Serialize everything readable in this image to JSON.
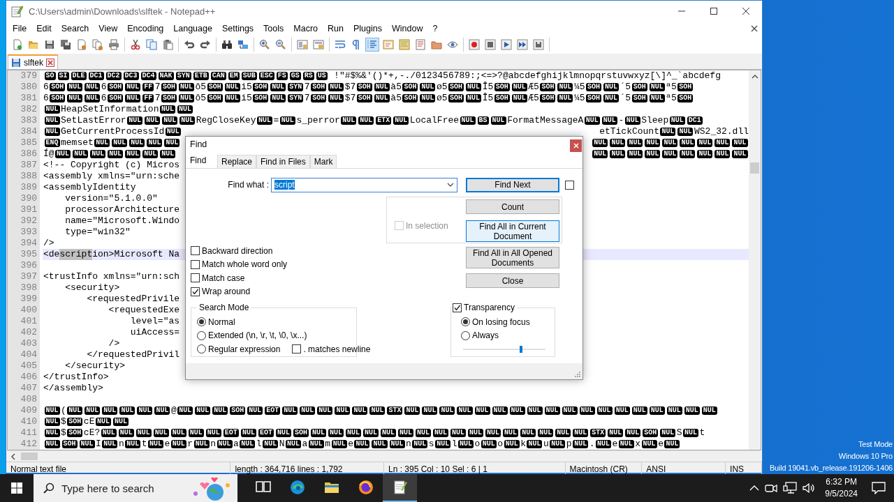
{
  "window": {
    "title": "C:\\Users\\admin\\Downloads\\slftek - Notepad++"
  },
  "menu": [
    "File",
    "Edit",
    "Search",
    "View",
    "Encoding",
    "Language",
    "Settings",
    "Tools",
    "Macro",
    "Run",
    "Plugins",
    "Window",
    "?"
  ],
  "toolbar": [
    [
      {
        "kind": "new",
        "pressed": false
      },
      {
        "kind": "open",
        "pressed": false
      },
      {
        "kind": "save",
        "pressed": false
      },
      {
        "kind": "save-all",
        "pressed": false
      },
      {
        "kind": "close",
        "pressed": false
      },
      {
        "kind": "close-all",
        "pressed": false
      },
      {
        "kind": "print",
        "pressed": false
      }
    ],
    [
      {
        "kind": "cut",
        "pressed": false
      },
      {
        "kind": "copy",
        "pressed": false
      },
      {
        "kind": "paste",
        "pressed": false
      }
    ],
    [
      {
        "kind": "undo",
        "pressed": false
      },
      {
        "kind": "redo",
        "pressed": false
      }
    ],
    [
      {
        "kind": "find",
        "pressed": false
      },
      {
        "kind": "replace",
        "pressed": false
      }
    ],
    [
      {
        "kind": "zoom-in",
        "pressed": false
      },
      {
        "kind": "zoom-out",
        "pressed": false
      }
    ],
    [
      {
        "kind": "sync-v",
        "pressed": false
      },
      {
        "kind": "sync-h",
        "pressed": false
      }
    ],
    [
      {
        "kind": "wrap",
        "pressed": false
      },
      {
        "kind": "all-chars",
        "pressed": false
      },
      {
        "kind": "indent",
        "pressed": true
      },
      {
        "kind": "udl",
        "pressed": false
      },
      {
        "kind": "map",
        "pressed": false
      },
      {
        "kind": "func",
        "pressed": false
      },
      {
        "kind": "folder",
        "pressed": false
      },
      {
        "kind": "monitor",
        "pressed": false
      }
    ],
    [
      {
        "kind": "record",
        "pressed": false
      },
      {
        "kind": "stop",
        "pressed": false
      },
      {
        "kind": "play",
        "pressed": false
      },
      {
        "kind": "play-multi",
        "pressed": false
      },
      {
        "kind": "save-macro",
        "pressed": false
      }
    ]
  ],
  "tabs": [
    {
      "label": "slftek",
      "selected": true
    }
  ],
  "editor": {
    "lines": [
      {
        "number": "379",
        "current": false,
        "segments": [
          {
            "ctrl": "SO"
          },
          {
            "ctrl": "SI"
          },
          {
            "ctrl": "DLE"
          },
          {
            "ctrl": "DC1"
          },
          {
            "ctrl": "DC2"
          },
          {
            "ctrl": "DC3"
          },
          {
            "ctrl": "DC4"
          },
          {
            "ctrl": "NAK"
          },
          {
            "ctrl": "SYN"
          },
          {
            "ctrl": "ETB"
          },
          {
            "ctrl": "CAN"
          },
          {
            "ctrl": "EM"
          },
          {
            "ctrl": "SUB"
          },
          {
            "ctrl": "ESC"
          },
          {
            "ctrl": "FS"
          },
          {
            "ctrl": "GS"
          },
          {
            "ctrl": "RS"
          },
          {
            "ctrl": "US"
          },
          {
            "text": " !\"#$%&'()*+,-./0123456789:;<=>?@abcdefghijklmnopqrstuvwxyz[\\]^_`abcdefg"
          }
        ]
      },
      {
        "number": "380",
        "current": false,
        "segments": [
          {
            "text": "6"
          },
          {
            "ctrl": "SOH"
          },
          {
            "ctrl": "NUL"
          },
          {
            "ctrl": "NUL"
          },
          {
            "text": "6"
          },
          {
            "ctrl": "SOH"
          },
          {
            "ctrl": "NUL"
          },
          {
            "ctrl": "FF"
          },
          {
            "text": "7"
          },
          {
            "ctrl": "SOH"
          },
          {
            "ctrl": "NUL"
          },
          {
            "text": "ô5"
          },
          {
            "ctrl": "SOH"
          },
          {
            "ctrl": "NUL"
          },
          {
            "text": "i5"
          },
          {
            "ctrl": "SOH"
          },
          {
            "ctrl": "NUL"
          },
          {
            "ctrl": "SYN"
          },
          {
            "text": "7"
          },
          {
            "ctrl": "SOH"
          },
          {
            "ctrl": "NUL"
          },
          {
            "text": "$7"
          },
          {
            "ctrl": "SOH"
          },
          {
            "ctrl": "NUL"
          },
          {
            "text": "à5"
          },
          {
            "ctrl": "SOH"
          },
          {
            "ctrl": "NUL"
          },
          {
            "text": "ø5"
          },
          {
            "ctrl": "SOH"
          },
          {
            "ctrl": "NUL"
          },
          {
            "text": "Î5"
          },
          {
            "ctrl": "SOH"
          },
          {
            "ctrl": "NUL"
          },
          {
            "text": "Æ5"
          },
          {
            "ctrl": "SOH"
          },
          {
            "ctrl": "NUL"
          },
          {
            "text": "¼5"
          },
          {
            "ctrl": "SOH"
          },
          {
            "ctrl": "NUL"
          },
          {
            "text": "´5"
          },
          {
            "ctrl": "SOH"
          },
          {
            "ctrl": "NUL"
          },
          {
            "text": "ª5"
          },
          {
            "ctrl": "SOH"
          }
        ]
      },
      {
        "number": "381",
        "current": false,
        "segments": [
          {
            "text": "6"
          },
          {
            "ctrl": "SOH"
          },
          {
            "ctrl": "NUL"
          },
          {
            "ctrl": "NUL"
          },
          {
            "text": "6"
          },
          {
            "ctrl": "SOH"
          },
          {
            "ctrl": "NUL"
          },
          {
            "ctrl": "FF"
          },
          {
            "text": "7"
          },
          {
            "ctrl": "SOH"
          },
          {
            "ctrl": "NUL"
          },
          {
            "text": "ô5"
          },
          {
            "ctrl": "SOH"
          },
          {
            "ctrl": "NUL"
          },
          {
            "text": "i5"
          },
          {
            "ctrl": "SOH"
          },
          {
            "ctrl": "NUL"
          },
          {
            "ctrl": "SYN"
          },
          {
            "text": "7"
          },
          {
            "ctrl": "SOH"
          },
          {
            "ctrl": "NUL"
          },
          {
            "text": "$7"
          },
          {
            "ctrl": "SOH"
          },
          {
            "ctrl": "NUL"
          },
          {
            "text": "à5"
          },
          {
            "ctrl": "SOH"
          },
          {
            "ctrl": "NUL"
          },
          {
            "text": "ø5"
          },
          {
            "ctrl": "SOH"
          },
          {
            "ctrl": "NUL"
          },
          {
            "text": "Î5"
          },
          {
            "ctrl": "SOH"
          },
          {
            "ctrl": "NUL"
          },
          {
            "text": "Æ5"
          },
          {
            "ctrl": "SOH"
          },
          {
            "ctrl": "NUL"
          },
          {
            "text": "¼5"
          },
          {
            "ctrl": "SOH"
          },
          {
            "ctrl": "NUL"
          },
          {
            "text": "´5"
          },
          {
            "ctrl": "SOH"
          },
          {
            "ctrl": "NUL"
          },
          {
            "text": "ª5"
          },
          {
            "ctrl": "SOH"
          }
        ]
      },
      {
        "number": "382",
        "current": false,
        "segments": [
          {
            "ctrl": "NUL"
          },
          {
            "text": "HeapSetInformation"
          },
          {
            "ctrl": "NUL"
          },
          {
            "ctrl": "NUL"
          }
        ]
      },
      {
        "number": "383",
        "current": false,
        "segments": [
          {
            "ctrl": "NUL"
          },
          {
            "text": "SetLastError"
          },
          {
            "ctrl": "NUL"
          },
          {
            "ctrl": "NUL"
          },
          {
            "ctrl": "NUL"
          },
          {
            "ctrl": "NUL"
          },
          {
            "text": "RegCloseKey"
          },
          {
            "ctrl": "NUL"
          },
          {
            "text": "="
          },
          {
            "ctrl": "NUL"
          },
          {
            "text": "s_perror"
          },
          {
            "ctrl": "NUL"
          },
          {
            "ctrl": "NUL"
          },
          {
            "ctrl": "ETX"
          },
          {
            "ctrl": "NUL"
          },
          {
            "text": "LocalFree"
          },
          {
            "ctrl": "NUL"
          },
          {
            "ctrl": "BS"
          },
          {
            "ctrl": "NUL"
          },
          {
            "text": "FormatMessageA"
          },
          {
            "ctrl": "NUL"
          },
          {
            "ctrl": "NUL"
          },
          {
            "text": "-"
          },
          {
            "ctrl": "NUL"
          },
          {
            "text": "Sleep"
          },
          {
            "ctrl": "NUL"
          },
          {
            "ctrl": "DC1"
          }
        ]
      },
      {
        "number": "384",
        "current": false,
        "segments": [
          {
            "ctrl": "NUL"
          },
          {
            "text": "GetCurrentProcessId"
          },
          {
            "ctrl": "NUL"
          }
        ],
        "tail": [
          {
            "text": "etTickCount"
          },
          {
            "ctrl": "NUL"
          },
          {
            "ctrl": "NUL"
          },
          {
            "text": "WS2_32.dll"
          }
        ]
      },
      {
        "number": "385",
        "current": false,
        "segments": [
          {
            "ctrl": "ENQ"
          },
          {
            "text": "memset"
          },
          {
            "ctrl": "NUL"
          },
          {
            "ctrl": "NUL"
          },
          {
            "ctrl": "NUL"
          },
          {
            "ctrl": "NUL"
          },
          {
            "ctrl": "NUL"
          }
        ],
        "tail": [
          {
            "ctrl": "NUL"
          },
          {
            "ctrl": "NUL"
          },
          {
            "ctrl": "NUL"
          },
          {
            "ctrl": "NUL"
          },
          {
            "ctrl": "NUL"
          },
          {
            "ctrl": "NUL"
          },
          {
            "ctrl": "NUL"
          },
          {
            "ctrl": "NUL"
          },
          {
            "ctrl": "NUL"
          }
        ]
      },
      {
        "number": "386",
        "current": false,
        "segments": [
          {
            "text": "Í@"
          },
          {
            "ctrl": "NUL"
          },
          {
            "ctrl": "NUL"
          },
          {
            "ctrl": "NUL"
          },
          {
            "ctrl": "NUL"
          },
          {
            "ctrl": "NUL"
          },
          {
            "ctrl": "NUL"
          },
          {
            "ctrl": "NUL"
          }
        ],
        "tail": [
          {
            "ctrl": "NUL"
          },
          {
            "ctrl": "NUL"
          },
          {
            "ctrl": "NUL"
          },
          {
            "ctrl": "NUL"
          },
          {
            "ctrl": "NUL"
          },
          {
            "ctrl": "NUL"
          },
          {
            "ctrl": "NUL"
          },
          {
            "ctrl": "NUL"
          },
          {
            "ctrl": "NUL"
          }
        ]
      },
      {
        "number": "387",
        "current": false,
        "segments": [
          {
            "text": "<!-- Copyright (c) Micros"
          }
        ]
      },
      {
        "number": "388",
        "current": false,
        "segments": [
          {
            "text": "<assembly xmlns=\"urn:sche"
          }
        ]
      },
      {
        "number": "389",
        "current": false,
        "segments": [
          {
            "text": "<assemblyIdentity"
          }
        ]
      },
      {
        "number": "390",
        "current": false,
        "segments": [
          {
            "text": "    version=\"5.1.0.0\""
          }
        ]
      },
      {
        "number": "391",
        "current": false,
        "segments": [
          {
            "text": "    processorArchitecture"
          }
        ]
      },
      {
        "number": "392",
        "current": false,
        "segments": [
          {
            "text": "    name=\"Microsoft.Windo"
          }
        ]
      },
      {
        "number": "393",
        "current": false,
        "segments": [
          {
            "text": "    type=\"win32\""
          }
        ]
      },
      {
        "number": "394",
        "current": false,
        "segments": [
          {
            "text": "/>"
          }
        ]
      },
      {
        "number": "395",
        "current": true,
        "segments": [
          {
            "text": "<de"
          },
          {
            "match": "script"
          },
          {
            "text": "ion>Microsoft Na"
          }
        ]
      },
      {
        "number": "396",
        "current": false
      },
      {
        "number": "397",
        "current": false,
        "segments": [
          {
            "text": "<trustInfo xmlns=\"urn:sch"
          }
        ]
      },
      {
        "number": "398",
        "current": false,
        "segments": [
          {
            "text": "    <security>"
          }
        ]
      },
      {
        "number": "399",
        "current": false,
        "segments": [
          {
            "text": "        <requestedPrivile"
          }
        ]
      },
      {
        "number": "400",
        "current": false,
        "segments": [
          {
            "text": "            <requestedExe"
          }
        ]
      },
      {
        "number": "401",
        "current": false,
        "segments": [
          {
            "text": "                level=\"as"
          }
        ]
      },
      {
        "number": "402",
        "current": false,
        "segments": [
          {
            "text": "                uiAccess="
          }
        ]
      },
      {
        "number": "403",
        "current": false,
        "segments": [
          {
            "text": "            />"
          }
        ]
      },
      {
        "number": "404",
        "current": false,
        "segments": [
          {
            "text": "        </requestedPrivil"
          }
        ]
      },
      {
        "number": "405",
        "current": false,
        "segments": [
          {
            "text": "    </security>"
          }
        ]
      },
      {
        "number": "406",
        "current": false,
        "segments": [
          {
            "text": "</trustInfo>"
          }
        ]
      },
      {
        "number": "407",
        "current": false,
        "segments": [
          {
            "text": "</assembly>"
          }
        ]
      },
      {
        "number": "408",
        "current": false
      },
      {
        "number": "409",
        "current": false,
        "segments": [
          {
            "ctrl": "NUL"
          },
          {
            "text": "("
          },
          {
            "ctrl": "NUL"
          },
          {
            "ctrl": "NUL"
          },
          {
            "ctrl": "NUL"
          },
          {
            "ctrl": "NUL"
          },
          {
            "ctrl": "NUL"
          },
          {
            "ctrl": "NUL"
          },
          {
            "text": "@"
          },
          {
            "ctrl": "NUL"
          },
          {
            "ctrl": "NUL"
          },
          {
            "ctrl": "NUL"
          },
          {
            "ctrl": "SOH"
          },
          {
            "ctrl": "NUL"
          },
          {
            "ctrl": "EOT"
          },
          {
            "ctrl": "NUL"
          },
          {
            "ctrl": "NUL"
          },
          {
            "ctrl": "NUL"
          },
          {
            "ctrl": "NUL"
          },
          {
            "ctrl": "NUL"
          },
          {
            "ctrl": "NUL"
          },
          {
            "ctrl": "STX"
          },
          {
            "ctrl": "NUL"
          },
          {
            "ctrl": "NUL"
          },
          {
            "ctrl": "NUL"
          },
          {
            "ctrl": "NUL"
          },
          {
            "ctrl": "NUL"
          },
          {
            "ctrl": "NUL"
          },
          {
            "ctrl": "NUL"
          },
          {
            "ctrl": "NUL"
          },
          {
            "ctrl": "NUL"
          },
          {
            "ctrl": "NUL"
          },
          {
            "ctrl": "NUL"
          },
          {
            "ctrl": "NUL"
          },
          {
            "ctrl": "NUL"
          },
          {
            "ctrl": "NUL"
          },
          {
            "ctrl": "NUL"
          },
          {
            "ctrl": "NUL"
          },
          {
            "ctrl": "NUL"
          },
          {
            "ctrl": "NUL"
          }
        ]
      },
      {
        "number": "410",
        "current": false,
        "segments": [
          {
            "ctrl": "NUL"
          },
          {
            "text": "$"
          },
          {
            "ctrl": "SOH"
          },
          {
            "text": "cE"
          },
          {
            "ctrl": "NUL"
          },
          {
            "ctrl": "NUL"
          }
        ]
      },
      {
        "number": "411",
        "current": false,
        "segments": [
          {
            "ctrl": "NUL"
          },
          {
            "text": "$"
          },
          {
            "ctrl": "SOH"
          },
          {
            "text": "cE?"
          },
          {
            "ctrl": "NUL"
          },
          {
            "ctrl": "NUL"
          },
          {
            "ctrl": "NUL"
          },
          {
            "ctrl": "NUL"
          },
          {
            "ctrl": "NUL"
          },
          {
            "ctrl": "NUL"
          },
          {
            "ctrl": "NUL"
          },
          {
            "ctrl": "EOT"
          },
          {
            "ctrl": "NUL"
          },
          {
            "ctrl": "EOT"
          },
          {
            "ctrl": "NUL"
          },
          {
            "ctrl": "SOH"
          },
          {
            "ctrl": "NUL"
          },
          {
            "ctrl": "NUL"
          },
          {
            "ctrl": "NUL"
          },
          {
            "ctrl": "NUL"
          },
          {
            "ctrl": "NUL"
          },
          {
            "ctrl": "NUL"
          },
          {
            "ctrl": "NUL"
          },
          {
            "ctrl": "NUL"
          },
          {
            "ctrl": "NUL"
          },
          {
            "ctrl": "NUL"
          },
          {
            "ctrl": "NUL"
          },
          {
            "ctrl": "NUL"
          },
          {
            "ctrl": "NUL"
          },
          {
            "ctrl": "NUL"
          },
          {
            "ctrl": "NUL"
          },
          {
            "ctrl": "NUL"
          },
          {
            "ctrl": "STX"
          },
          {
            "ctrl": "NUL"
          },
          {
            "ctrl": "NUL"
          },
          {
            "ctrl": "SOH"
          },
          {
            "ctrl": "NUL"
          },
          {
            "text": "S"
          },
          {
            "ctrl": "NUL"
          },
          {
            "text": "t"
          }
        ]
      },
      {
        "number": "412",
        "current": false,
        "segments": [
          {
            "ctrl": "NUL"
          },
          {
            "ctrl": "SOH"
          },
          {
            "ctrl": "NUL"
          },
          {
            "text": "I"
          },
          {
            "ctrl": "NUL"
          },
          {
            "text": "n"
          },
          {
            "ctrl": "NUL"
          },
          {
            "text": "t"
          },
          {
            "ctrl": "NUL"
          },
          {
            "text": "e"
          },
          {
            "ctrl": "NUL"
          },
          {
            "text": "r"
          },
          {
            "ctrl": "NUL"
          },
          {
            "text": "n"
          },
          {
            "ctrl": "NUL"
          },
          {
            "text": "a"
          },
          {
            "ctrl": "NUL"
          },
          {
            "text": "l"
          },
          {
            "ctrl": "NUL"
          },
          {
            "text": "N"
          },
          {
            "ctrl": "NUL"
          },
          {
            "text": "a"
          },
          {
            "ctrl": "NUL"
          },
          {
            "text": "m"
          },
          {
            "ctrl": "NUL"
          },
          {
            "text": "e"
          },
          {
            "ctrl": "NUL"
          },
          {
            "ctrl": "NUL"
          },
          {
            "ctrl": "NUL"
          },
          {
            "text": "n"
          },
          {
            "ctrl": "NUL"
          },
          {
            "text": "s"
          },
          {
            "ctrl": "NUL"
          },
          {
            "text": "l"
          },
          {
            "ctrl": "NUL"
          },
          {
            "text": "o"
          },
          {
            "ctrl": "NUL"
          },
          {
            "text": "o"
          },
          {
            "ctrl": "NUL"
          },
          {
            "text": "k"
          },
          {
            "ctrl": "NUL"
          },
          {
            "text": "u"
          },
          {
            "ctrl": "NUL"
          },
          {
            "text": "p"
          },
          {
            "ctrl": "NUL"
          },
          {
            "text": "."
          },
          {
            "ctrl": "NUL"
          },
          {
            "text": "e"
          },
          {
            "ctrl": "NUL"
          },
          {
            "text": "x"
          },
          {
            "ctrl": "NUL"
          },
          {
            "text": "e"
          },
          {
            "ctrl": "NUL"
          }
        ]
      }
    ]
  },
  "status_bar": [
    "Normal text file",
    "length : 364,716    lines : 1,792",
    "Ln : 395    Col : 10    Sel : 6 | 1",
    "Macintosh (CR)",
    "ANSI",
    "INS"
  ],
  "find_dialog": {
    "title": "Find",
    "tabs": [
      {
        "label": "Find",
        "selected": true
      },
      {
        "label": "Replace",
        "selected": false
      },
      {
        "label": "Find in Files",
        "selected": false
      },
      {
        "label": "Mark",
        "selected": false
      }
    ],
    "find_what": {
      "label": "Find what :",
      "value": "script"
    },
    "find_next_toggle": {
      "checked": false
    },
    "buttons": [
      {
        "label": "Find Next",
        "focused": true,
        "hovered": false
      },
      {
        "label": "Count",
        "focused": false,
        "hovered": false
      },
      {
        "label": "Find All in Current Document",
        "focused": false,
        "hovered": true
      },
      {
        "label": "Find All in All Opened Documents",
        "focused": false,
        "hovered": false
      },
      {
        "label": "Close",
        "focused": false,
        "hovered": false
      }
    ],
    "in_selection": {
      "label": "In selection",
      "checked": false,
      "disabled": true
    },
    "options": [
      {
        "label": "Backward direction",
        "checked": false
      },
      {
        "label": "Match whole word only",
        "checked": false
      },
      {
        "label": "Match case",
        "checked": false
      },
      {
        "label": "Wrap around",
        "checked": true
      }
    ],
    "search_mode": {
      "title": "Search Mode",
      "modes": [
        {
          "label": "Normal",
          "selected": true
        },
        {
          "label": "Extended (\\n, \\r, \\t, \\0, \\x...)",
          "selected": false
        },
        {
          "label": "Regular expression",
          "selected": false
        }
      ],
      "dot_matches_newline": {
        "label": ". matches newline",
        "checked": false
      }
    },
    "transparency": {
      "label": "Transparency",
      "checked": true,
      "modes": [
        {
          "label": "On losing focus",
          "selected": true
        },
        {
          "label": "Always",
          "selected": false
        }
      ],
      "level": 0.7
    }
  },
  "desktop_info": [
    "Test Mode",
    "Windows 10 Pro",
    "Build 19041.vb_release.191206-1406"
  ],
  "taskbar": {
    "search": {
      "placeholder": "Type here to search"
    },
    "apps": [
      {
        "kind": "task-view",
        "active": false
      },
      {
        "kind": "edge",
        "active": false
      },
      {
        "kind": "explorer",
        "active": false
      },
      {
        "kind": "firefox",
        "active": false
      },
      {
        "kind": "notepad",
        "active": true
      }
    ],
    "time": "6:32 PM",
    "date": "9/5/2024"
  }
}
